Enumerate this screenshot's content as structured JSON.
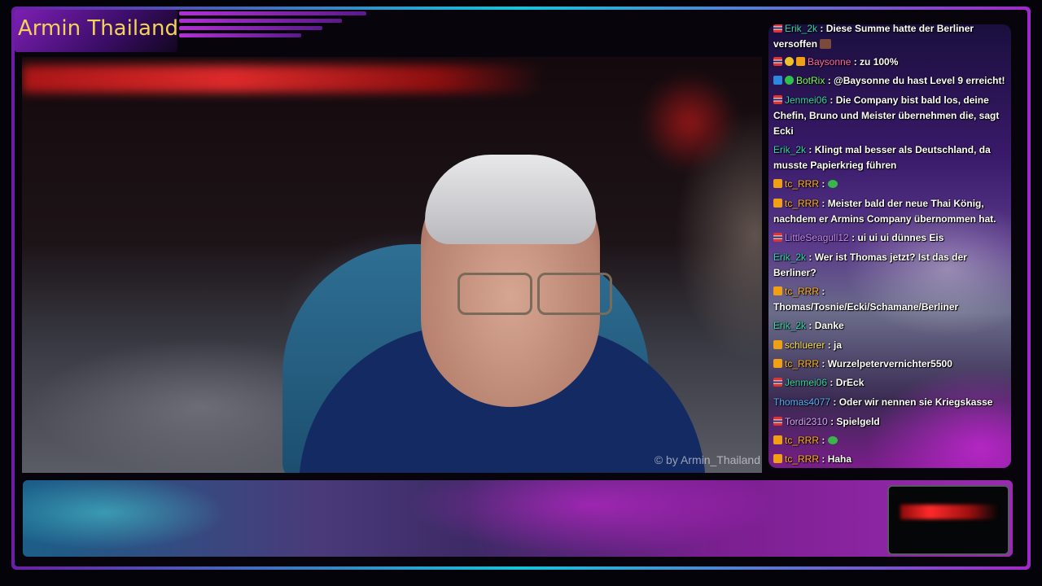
{
  "stream": {
    "title": "Armin Thailand",
    "watermark": "© by Armin_Thailand"
  },
  "colors": {
    "title": "#f2d25a",
    "frame_accent_1": "#6a1fa5",
    "frame_accent_2": "#18c4d8"
  },
  "chat": {
    "messages": [
      {
        "user": "Erik_2k",
        "text": ": Diese Summe hatte der Berliner versoffen",
        "badges": [
          "flag"
        ],
        "emote": "brown-face-emote"
      },
      {
        "user": "Baysonne",
        "text": ": zu 100%",
        "badges": [
          "flag",
          "prime",
          "sub"
        ]
      },
      {
        "user": "BotRix",
        "text": ": @Baysonne du hast Level 9 erreicht!",
        "badges": [
          "mod",
          "check"
        ]
      },
      {
        "user": "Jenmei06",
        "text": ": Die Company bist bald los, deine Chefin, Bruno und Meister übernehmen die, sagt Ecki",
        "badges": [
          "flag"
        ]
      },
      {
        "user": "Erik_2k",
        "text": ": Klingt mal besser als Deutschland, da musste Papierkrieg führen",
        "badges": []
      },
      {
        "user": "tc_RRR",
        "text": ":",
        "badges": [
          "sub"
        ],
        "emote": "green-emote"
      },
      {
        "user": "tc_RRR",
        "text": ": Meister bald der neue Thai König, nachdem er Armins Company übernommen hat.",
        "badges": [
          "sub"
        ]
      },
      {
        "user": "LittleSeagull12",
        "text": ": ui ui ui dünnes Eis",
        "badges": [
          "flag"
        ]
      },
      {
        "user": "Erik_2k",
        "text": ": Wer ist Thomas jetzt? Ist das der Berliner?",
        "badges": []
      },
      {
        "user": "tc_RRR",
        "text": ": Thomas/Tosnie/Ecki/Schamane/Berliner",
        "badges": [
          "sub"
        ]
      },
      {
        "user": "Erik_2k",
        "text": ": Danke",
        "badges": []
      },
      {
        "user": "schluerer",
        "text": ": ja",
        "badges": [
          "sub"
        ]
      },
      {
        "user": "tc_RRR",
        "text": ": Wurzelpetervernichter5500",
        "badges": [
          "sub"
        ]
      },
      {
        "user": "Jenmei06",
        "text": ": DrEck",
        "badges": [
          "flag"
        ]
      },
      {
        "user": "Thomas4077",
        "text": ": Oder wir nennen sie Kriegskasse",
        "badges": []
      },
      {
        "user": "Tordi2310",
        "text": ": Spielgeld",
        "badges": [
          "flag"
        ]
      },
      {
        "user": "tc_RRR",
        "text": ":",
        "badges": [
          "sub"
        ],
        "emote": "green-emote"
      },
      {
        "user": "tc_RRR",
        "text": ": Haha",
        "badges": [
          "sub"
        ]
      }
    ]
  }
}
